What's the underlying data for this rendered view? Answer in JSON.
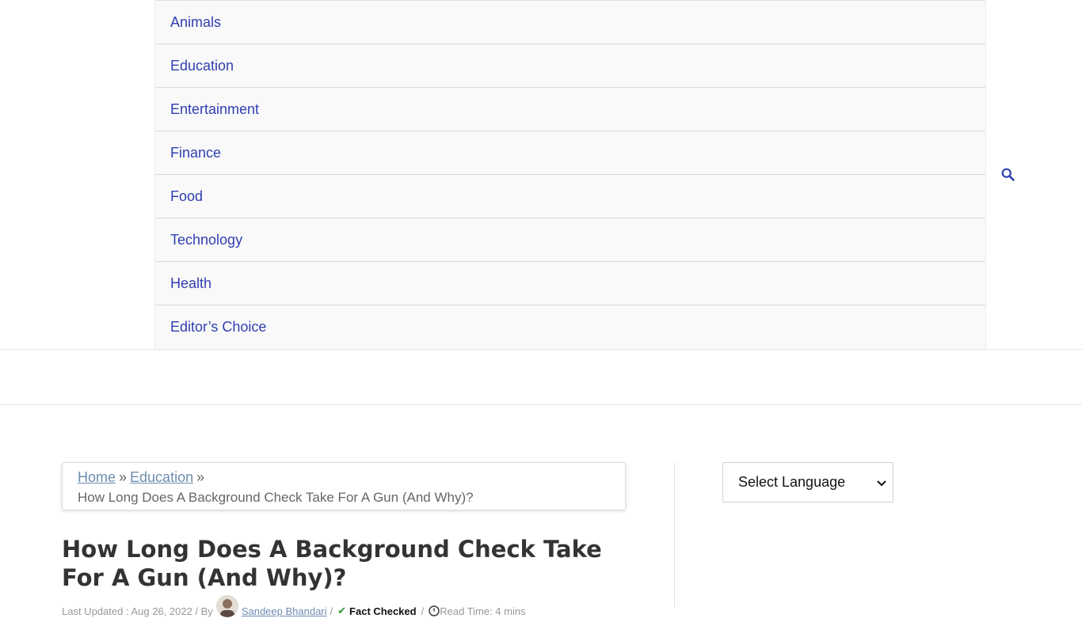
{
  "nav": {
    "items": [
      {
        "label": "Animals"
      },
      {
        "label": "Education"
      },
      {
        "label": "Entertainment"
      },
      {
        "label": "Finance"
      },
      {
        "label": "Food"
      },
      {
        "label": "Technology"
      },
      {
        "label": "Health"
      },
      {
        "label": "Editor’s Choice"
      }
    ],
    "search_icon": "search-icon"
  },
  "breadcrumb": {
    "home": "Home",
    "education": "Education",
    "separator": "»",
    "current": "How Long Does A Background Check Take For A Gun (And Why)?"
  },
  "article": {
    "title": "How Long Does A Background Check Take For A Gun (And Why)?",
    "meta": {
      "last_updated": "Last Updated : Aug 26, 2022 / By",
      "author": "Sandeep Bhandari",
      "slash1": "/",
      "fact_checked": "Fact Checked",
      "slash2": "/",
      "read_time": "Read Time: 4 mins"
    }
  },
  "sidebar": {
    "language_select": "Select Language"
  },
  "colors": {
    "nav_link": "#2f3fb0",
    "breadcrumb_link": "#6e8db0",
    "title": "#333333"
  }
}
